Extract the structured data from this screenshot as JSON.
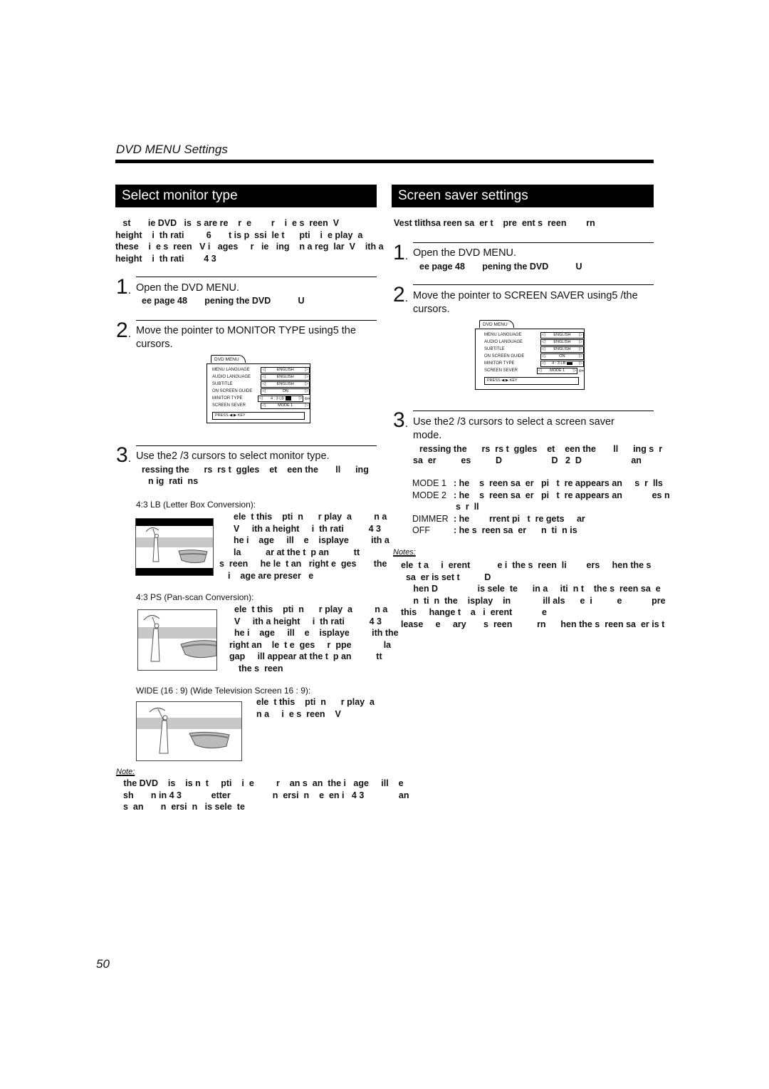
{
  "header": {
    "section_title": "DVD MENU Settings"
  },
  "left": {
    "banner": "Select monitor type",
    "intro": [
      "   st       ie DVD   is  s are re    r  e        r    i  e s  reen  V",
      "height    i  th rati         6       t is p  ssi  le t      pti    i  e play  a",
      "these    i  e s  reen   V i   ages     r   ie   ing    n a reg  lar  V    ith a",
      "height    i  th rati        4 3"
    ],
    "steps": [
      {
        "num": "1",
        "text": "Open the DVD MENU.",
        "sub": "ee page 48       pening the DVD           U"
      },
      {
        "num": "2",
        "text": "Move the pointer to MONITOR TYPE using5 the",
        "text2": "cursors."
      },
      {
        "num": "3",
        "text": "Use the2 /3  cursors to select monitor type.",
        "sub": "ressing the      rs  rs t  ggles    et    een the       ll      ing",
        "sub2": "n ig  rati  ns"
      }
    ],
    "menu": {
      "tab": "DVD MENU",
      "rows": [
        {
          "key": "MENU LANGUAGE",
          "value": "ENGLISH"
        },
        {
          "key": "AUDIO LANGUAGE",
          "value": "ENGLISH"
        },
        {
          "key": "SUBTITLE",
          "value": "ENGLISH"
        },
        {
          "key": "ON SCREEN GUIDE",
          "value": "ON"
        },
        {
          "key": "MINITOR TYPE",
          "value": "4 : 3 LB"
        },
        {
          "key": "SCREEN SEVER",
          "value": "MODE 1"
        }
      ],
      "press": "PRESS ◀ ▶ KEY",
      "pointer_row": "MINITOR TYPE"
    },
    "options": [
      {
        "label": "4:3 LB (Letter Box Conversion):",
        "desc": [
          "ele  t this    pti  n      r play  a         n a",
          "V     ith a height     i  th rati          4 3",
          "he i    age     ill    e    isplaye         ith a",
          "la          ar at the t  p an          tt",
          "s  reen     he le  t an   right e  ges       the",
          "i    age are preser   e"
        ]
      },
      {
        "label": "4:3 PS (Pan-scan Conversion):",
        "desc": [
          "ele  t this    pti  n      r play  a         n a",
          "V     ith a height     i  th rati          4 3",
          "he i    age     ill    e    isplaye         ith the",
          "right an    le  t e  ges     r  ppe             la",
          "gap     ill appear at the t  p an          tt",
          "  the s  reen"
        ]
      },
      {
        "label": "WIDE (16 : 9) (Wide Television Screen 16 : 9):",
        "desc": [
          "ele  t this    pti  n      r play  a",
          "n a     i  e s  reen    V"
        ]
      }
    ],
    "note": {
      "label": "Note:",
      "lines": [
        "   the DVD    is    is n  t     pti    i  e         r    an s  an  the i   age     ill    e",
        "sh       n in 4 3            etter                 n  ersi  n    e  en i   4 3              an",
        "s  an       n  ersi  n   is sele  te"
      ]
    }
  },
  "right": {
    "banner": "Screen saver settings",
    "intro": [
      "Vest tlithsa reen sa  er t    pre  ent s  reen        rn"
    ],
    "steps": [
      {
        "num": "1",
        "text": "Open the DVD MENU.",
        "sub": "ee page 48       pening the DVD           U"
      },
      {
        "num": "2",
        "text": "Move the pointer to SCREEN SAVER using5 /the",
        "text2": "cursors."
      },
      {
        "num": "3",
        "text": "Use the2 /3  cursors to select a screen saver",
        "text2": "mode.",
        "sub": "ressing the      rs  rs t  ggles    et    een the       ll      ing s  r",
        "sub2": "sa  er          es          D                    D   2  D                    an"
      }
    ],
    "menu": {
      "tab": "DVD MENU",
      "rows": [
        {
          "key": "MENU LANGUAGE",
          "value": "ENGLISH"
        },
        {
          "key": "AUDIO LANGUAGE",
          "value": "ENGLISH"
        },
        {
          "key": "SUBTITLE",
          "value": "ENGLISH"
        },
        {
          "key": "ON SCREEN GUIDE",
          "value": "ON"
        },
        {
          "key": "MINITOR TYPE",
          "value": "4 : 3 LB"
        },
        {
          "key": "SCREEN SEVER",
          "value": "MODE 1"
        }
      ],
      "press": "PRESS ◀ ▶ KEY",
      "pointer_row": "SCREEN SEVER"
    },
    "modes": [
      {
        "key": "MODE 1",
        "desc": ": he    s  reen sa  er   pi   t  re appears an     s  r  lls"
      },
      {
        "key": "MODE 2",
        "desc": ": he    s  reen sa  er   pi   t  re appears an            es n",
        "desc2": "s  r  ll"
      },
      {
        "key": "DIMMER",
        "desc": ": he        rrent pi   t  re gets     ar"
      },
      {
        "key": "OFF",
        "desc": ": he s  reen sa  er      n  ti  n is"
      }
    ],
    "notes": {
      "label": "Notes:",
      "lines": [
        "ele  t a     i  erent           e i  the s  reen  li        ers     hen the s",
        "  sa  er is set t          D",
        "     hen D                is sele  te      in a     iti  n t    the s  reen sa  e",
        "     n  ti  n  the    isplay    in             ill als      e  i          e            pre",
        "this     hange t    a   i  erent            e",
        "lease     e     ary       s  reen          rn      hen the s  reen sa  er is t"
      ]
    }
  },
  "footer": {
    "page_number": "50"
  }
}
